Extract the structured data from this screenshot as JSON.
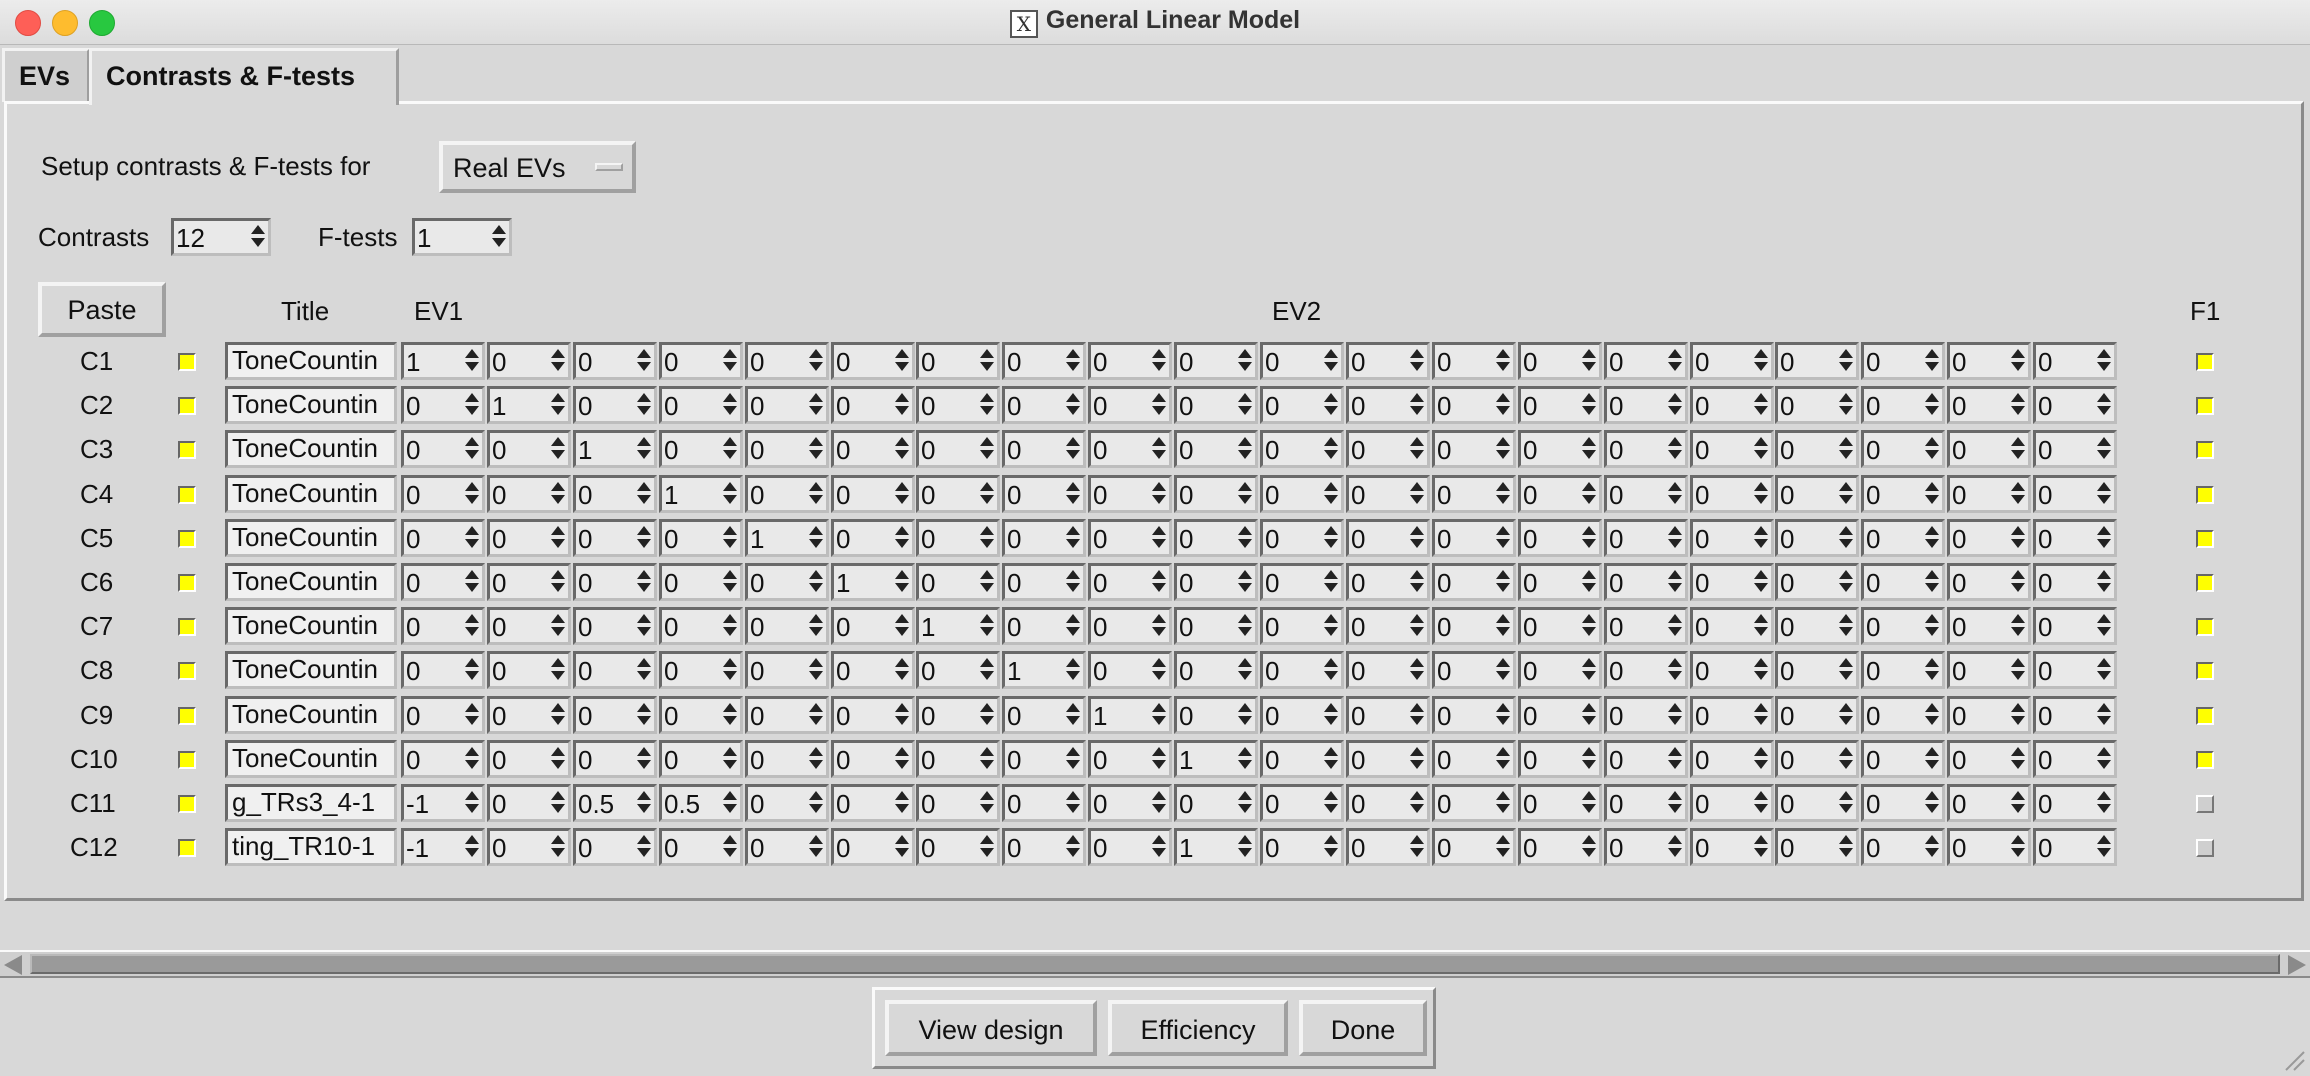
{
  "window": {
    "title": "General Linear Model"
  },
  "tabs": [
    {
      "label": "EVs",
      "active": false
    },
    {
      "label": "Contrasts & F-tests",
      "active": true
    }
  ],
  "setup": {
    "label": "Setup contrasts & F-tests for",
    "selected": "Real EVs"
  },
  "contrasts": {
    "label": "Contrasts",
    "value": "12"
  },
  "ftests": {
    "label": "F-tests",
    "value": "1"
  },
  "table": {
    "paste_label": "Paste",
    "title_header": "Title",
    "ev_headers": [
      "EV1",
      "EV2"
    ],
    "f_headers": [
      "F1"
    ],
    "rows": [
      {
        "label": "C1",
        "checked": true,
        "title": "ToneCountin",
        "values": [
          "1",
          "0",
          "0",
          "0",
          "0",
          "0",
          "0",
          "0",
          "0",
          "0",
          "0",
          "0",
          "0",
          "0",
          "0",
          "0",
          "0",
          "0",
          "0",
          "0"
        ],
        "f": [
          true
        ]
      },
      {
        "label": "C2",
        "checked": true,
        "title": "ToneCountin",
        "values": [
          "0",
          "1",
          "0",
          "0",
          "0",
          "0",
          "0",
          "0",
          "0",
          "0",
          "0",
          "0",
          "0",
          "0",
          "0",
          "0",
          "0",
          "0",
          "0",
          "0"
        ],
        "f": [
          true
        ]
      },
      {
        "label": "C3",
        "checked": true,
        "title": "ToneCountin",
        "values": [
          "0",
          "0",
          "1",
          "0",
          "0",
          "0",
          "0",
          "0",
          "0",
          "0",
          "0",
          "0",
          "0",
          "0",
          "0",
          "0",
          "0",
          "0",
          "0",
          "0"
        ],
        "f": [
          true
        ]
      },
      {
        "label": "C4",
        "checked": true,
        "title": "ToneCountin",
        "values": [
          "0",
          "0",
          "0",
          "1",
          "0",
          "0",
          "0",
          "0",
          "0",
          "0",
          "0",
          "0",
          "0",
          "0",
          "0",
          "0",
          "0",
          "0",
          "0",
          "0"
        ],
        "f": [
          true
        ]
      },
      {
        "label": "C5",
        "checked": true,
        "title": "ToneCountin",
        "values": [
          "0",
          "0",
          "0",
          "0",
          "1",
          "0",
          "0",
          "0",
          "0",
          "0",
          "0",
          "0",
          "0",
          "0",
          "0",
          "0",
          "0",
          "0",
          "0",
          "0"
        ],
        "f": [
          true
        ]
      },
      {
        "label": "C6",
        "checked": true,
        "title": "ToneCountin",
        "values": [
          "0",
          "0",
          "0",
          "0",
          "0",
          "1",
          "0",
          "0",
          "0",
          "0",
          "0",
          "0",
          "0",
          "0",
          "0",
          "0",
          "0",
          "0",
          "0",
          "0"
        ],
        "f": [
          true
        ]
      },
      {
        "label": "C7",
        "checked": true,
        "title": "ToneCountin",
        "values": [
          "0",
          "0",
          "0",
          "0",
          "0",
          "0",
          "1",
          "0",
          "0",
          "0",
          "0",
          "0",
          "0",
          "0",
          "0",
          "0",
          "0",
          "0",
          "0",
          "0"
        ],
        "f": [
          true
        ]
      },
      {
        "label": "C8",
        "checked": true,
        "title": "ToneCountin",
        "values": [
          "0",
          "0",
          "0",
          "0",
          "0",
          "0",
          "0",
          "1",
          "0",
          "0",
          "0",
          "0",
          "0",
          "0",
          "0",
          "0",
          "0",
          "0",
          "0",
          "0"
        ],
        "f": [
          true
        ]
      },
      {
        "label": "C9",
        "checked": true,
        "title": "ToneCountin",
        "values": [
          "0",
          "0",
          "0",
          "0",
          "0",
          "0",
          "0",
          "0",
          "1",
          "0",
          "0",
          "0",
          "0",
          "0",
          "0",
          "0",
          "0",
          "0",
          "0",
          "0"
        ],
        "f": [
          true
        ]
      },
      {
        "label": "C10",
        "checked": true,
        "title": "ToneCountin",
        "values": [
          "0",
          "0",
          "0",
          "0",
          "0",
          "0",
          "0",
          "0",
          "0",
          "1",
          "0",
          "0",
          "0",
          "0",
          "0",
          "0",
          "0",
          "0",
          "0",
          "0"
        ],
        "f": [
          true
        ]
      },
      {
        "label": "C11",
        "checked": true,
        "title": "g_TRs3_4-1",
        "values": [
          "-1",
          "0",
          "0.5",
          "0.5",
          "0",
          "0",
          "0",
          "0",
          "0",
          "0",
          "0",
          "0",
          "0",
          "0",
          "0",
          "0",
          "0",
          "0",
          "0",
          "0"
        ],
        "f": [
          false
        ]
      },
      {
        "label": "C12",
        "checked": true,
        "title": "ting_TR10-1",
        "values": [
          "-1",
          "0",
          "0",
          "0",
          "0",
          "0",
          "0",
          "0",
          "0",
          "1",
          "0",
          "0",
          "0",
          "0",
          "0",
          "0",
          "0",
          "0",
          "0",
          "0"
        ],
        "f": [
          false
        ]
      }
    ]
  },
  "buttons": {
    "view_design": "View design",
    "efficiency": "Efficiency",
    "done": "Done"
  },
  "colors": {
    "checkbox_on": "#ffff00",
    "background": "#d8d8d8"
  }
}
